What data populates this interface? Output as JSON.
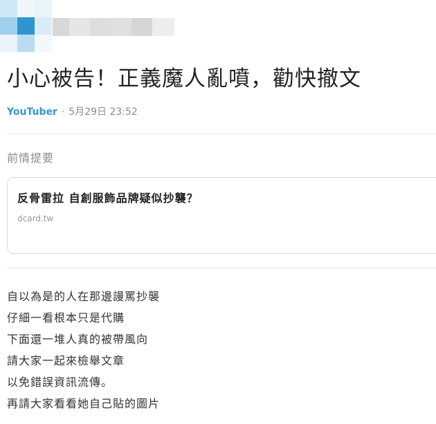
{
  "colors": {
    "author": "#3397cf",
    "title_text": "#222222",
    "muted_text": "#8c8c8c",
    "divider": "#e6e6e6",
    "blur_avatar": [
      "#cfe7f5",
      "#f0f6fa",
      "#eaf4fb",
      "#9fd0ee",
      "#2f94cf",
      "#d9edf8",
      "#eaf4fb",
      "#b9dcf2",
      "#f3f8fb"
    ],
    "blur_name": [
      "#d8d8d8",
      "#e6e6e6",
      "#dedede",
      "#e0e0e0",
      "#d6d6d6",
      "#ededed"
    ]
  },
  "post": {
    "title": "小心被告！正義魔人亂噴，勸快撤文",
    "author": "YouTuber",
    "separator": "·",
    "timestamp": "5月29日 23:52"
  },
  "section": {
    "label": "前情提要"
  },
  "link_card": {
    "title": "反骨雷拉 自創服飾品牌疑似抄襲？",
    "domain": "dcard.tw"
  },
  "body": {
    "lines": [
      "自以為是的人在那邊謾罵抄襲",
      "仔細一看根本只是代購",
      "下面還一堆人真的被帶風向",
      "請大家一起來檢舉文章",
      "以免錯誤資訊流傳。",
      "再請大家看看她自己貼的圖片"
    ]
  }
}
